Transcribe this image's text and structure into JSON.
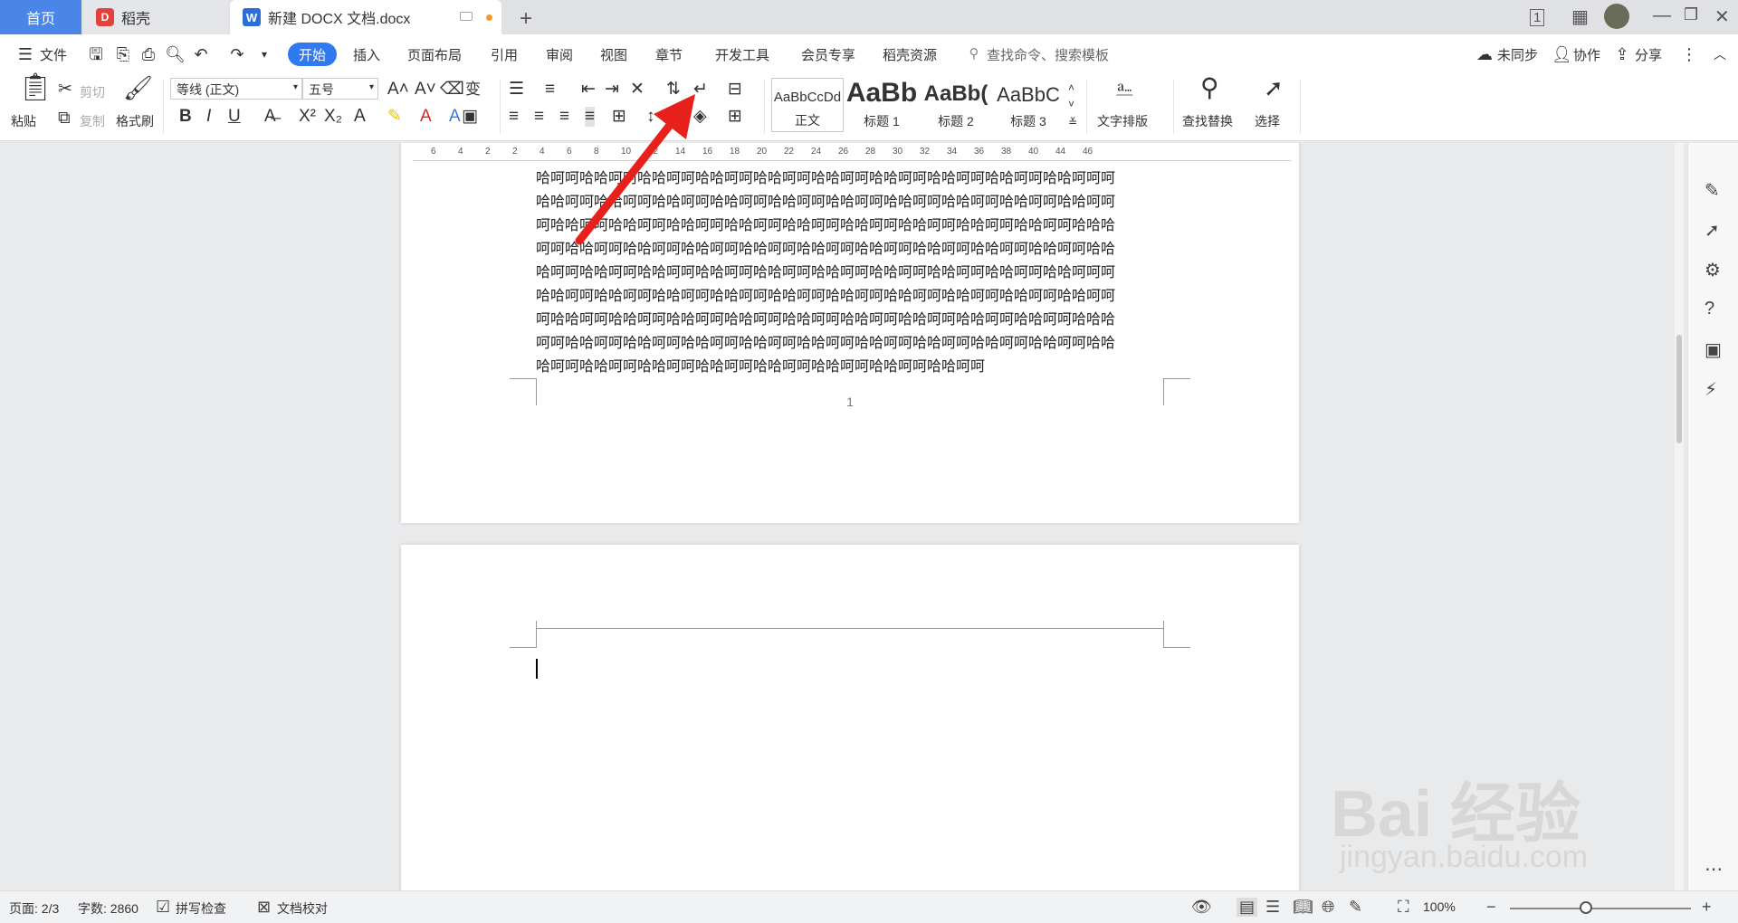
{
  "tabs": {
    "home": "首页",
    "daoke": "稻壳",
    "document": "新建 DOCX 文档.docx",
    "new_tab": "+"
  },
  "menu": {
    "file": "文件",
    "items": [
      "开始",
      "插入",
      "页面布局",
      "引用",
      "审阅",
      "视图",
      "章节",
      "开发工具",
      "会员专享",
      "稻壳资源"
    ],
    "search": "查找命令、搜索模板",
    "sync": "未同步",
    "collab": "协作",
    "share": "分享"
  },
  "ribbon": {
    "paste": "粘贴",
    "cut": "剪切",
    "copy": "复制",
    "format_painter": "格式刷",
    "font_name": "等线 (正文)",
    "font_size": "五号",
    "styles": [
      {
        "sample": "AaBbCcDd",
        "label": "正文"
      },
      {
        "sample": "AaBb",
        "label": "标题 1"
      },
      {
        "sample": "AaBb(",
        "label": "标题 2"
      },
      {
        "sample": "AaBbC",
        "label": "标题 3"
      }
    ],
    "text_layout": "文字排版",
    "find_replace": "查找替换",
    "select": "选择"
  },
  "ruler": {
    "ticks": [
      "6",
      "4",
      "2",
      "2",
      "4",
      "6",
      "8",
      "10",
      "12",
      "14",
      "16",
      "18",
      "20",
      "22",
      "24",
      "26",
      "28",
      "30",
      "32",
      "34",
      "36",
      "38",
      "40",
      "44",
      "46"
    ]
  },
  "document": {
    "lines": [
      "呵呵哈哈呵呵哈哈呵呵哈哈呵呵哈哈呵呵哈哈呵呵哈哈呵呵哈哈呵呵哈哈呵呵哈哈呵呵哈哈",
      "哈呵呵哈哈呵呵哈哈呵呵哈哈呵呵哈哈呵呵哈哈呵呵哈哈呵呵哈哈呵呵哈哈呵呵哈哈呵呵呵",
      "哈哈呵呵哈哈呵呵哈哈呵呵哈哈呵呵哈哈呵呵哈哈呵呵哈哈呵呵哈哈呵呵哈哈呵呵哈哈呵呵",
      "呵哈哈呵呵哈哈呵呵哈哈呵呵哈哈呵呵哈哈呵呵哈哈呵呵哈哈呵呵哈哈呵呵哈哈呵呵哈哈哈",
      "呵呵哈哈呵呵哈哈呵呵哈哈呵呵哈哈呵呵哈哈呵呵哈哈呵呵哈哈呵呵哈哈呵呵哈哈呵呵哈哈",
      "哈呵呵哈哈呵呵哈哈呵呵哈哈呵呵哈哈呵呵哈哈呵呵哈哈呵呵哈哈呵呵哈哈呵呵哈哈呵呵呵",
      "哈哈呵呵哈哈呵呵哈哈呵呵哈哈呵呵哈哈呵呵哈哈呵呵哈哈呵呵哈哈呵呵哈哈呵呵哈哈呵呵",
      "呵哈哈呵呵哈哈呵呵哈哈呵呵哈哈呵呵哈哈呵呵哈哈呵呵哈哈呵呵哈哈呵呵哈哈呵呵哈哈哈",
      "呵呵哈哈呵呵哈哈呵呵哈哈呵呵哈哈呵呵哈哈呵呵哈哈呵呵哈哈呵呵哈哈呵呵哈哈呵呵哈哈",
      "哈呵呵哈哈呵呵哈哈呵呵哈哈呵呵哈哈呵呵哈哈呵呵哈哈呵呵哈哈呵呵"
    ],
    "page_number": "1"
  },
  "status": {
    "page": "页面: 2/3",
    "words": "字数: 2860",
    "spell": "拼写检查",
    "proof": "文档校对",
    "zoom": "100%"
  },
  "watermark": {
    "text": "Bai 经验",
    "url": "jingyan.baidu.com"
  },
  "colors": {
    "accent": "#2f7af0",
    "home_tab": "#4a86e8",
    "arrow": "#e8201c"
  }
}
